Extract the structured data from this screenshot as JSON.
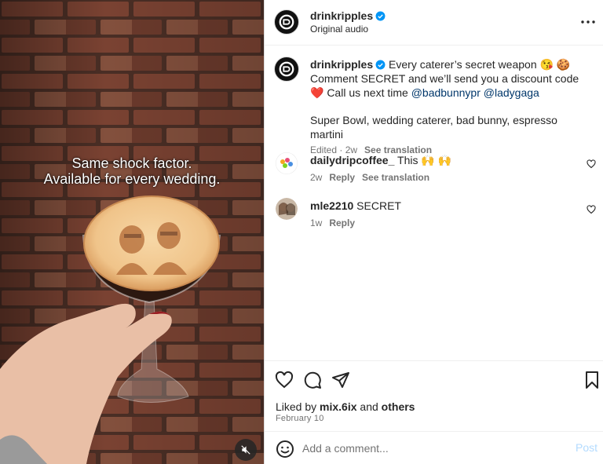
{
  "media": {
    "overlay_line1": "Same shock factor.",
    "overlay_line2": "Available for every wedding."
  },
  "header": {
    "username": "drinkripples",
    "subtitle": "Original audio"
  },
  "caption": {
    "username": "drinkripples",
    "text_part1": "Every caterer’s secret weapon 😘 🍪 Comment SECRET and we’ll send you a discount code ❤️ Call us next time",
    "mention1": "@badbunnypr",
    "mention2": "@ladygaga",
    "tags": "Super Bowl, wedding caterer, bad bunny, espresso martini",
    "edited": "Edited · 2w",
    "see_translation": "See translation"
  },
  "comments": [
    {
      "username": "dailydripcoffee_",
      "text": "This 🙌 🙌",
      "time": "2w",
      "reply": "Reply",
      "see_translation": "See translation"
    },
    {
      "username": "mle2210",
      "text": "SECRET",
      "time": "1w",
      "reply": "Reply"
    }
  ],
  "likes": {
    "prefix": "Liked by",
    "user": "mix.6ix",
    "and": "and",
    "others": "others"
  },
  "date": "February 10",
  "add_comment": {
    "placeholder": "Add a comment...",
    "post_label": "Post"
  },
  "colors": {
    "verified": "#0095f6",
    "link": "#00376b",
    "post_disabled": "#b3dbff"
  }
}
